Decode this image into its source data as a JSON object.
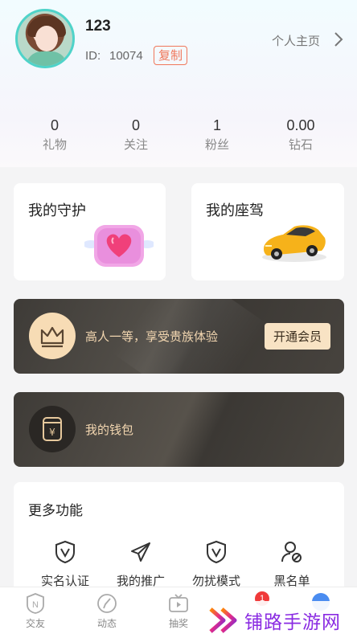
{
  "profile": {
    "username": "123",
    "id_label": "ID:",
    "id_value": "10074",
    "copy_label": "复制",
    "home_link": "个人主页"
  },
  "stats": [
    {
      "value": "0",
      "label": "礼物"
    },
    {
      "value": "0",
      "label": "关注"
    },
    {
      "value": "1",
      "label": "粉丝"
    },
    {
      "value": "0.00",
      "label": "钻石"
    }
  ],
  "cards": {
    "guard_title": "我的守护",
    "car_title": "我的座驾"
  },
  "vip": {
    "text": "高人一等，享受贵族体验",
    "button": "开通会员"
  },
  "wallet": {
    "text": "我的钱包"
  },
  "more": {
    "title": "更多功能",
    "features": [
      {
        "label": "实名认证",
        "icon": "verified-shield-icon"
      },
      {
        "label": "我的推广",
        "icon": "send-plane-icon"
      },
      {
        "label": "勿扰模式",
        "icon": "verified-shield-icon"
      },
      {
        "label": "黑名单",
        "icon": "user-block-icon"
      }
    ]
  },
  "tabs": [
    {
      "label": "交友",
      "icon": "n-badge-icon"
    },
    {
      "label": "动态",
      "icon": "compass-icon"
    },
    {
      "label": "抽奖",
      "icon": "tv-icon"
    }
  ],
  "tab_badge": "1",
  "watermark": "铺路手游网",
  "colors": {
    "accent_red": "#f0775a",
    "vip_gold": "#f2d6b0",
    "card_dark": "#3e3b37",
    "watermark_purple": "#8a2be2"
  }
}
